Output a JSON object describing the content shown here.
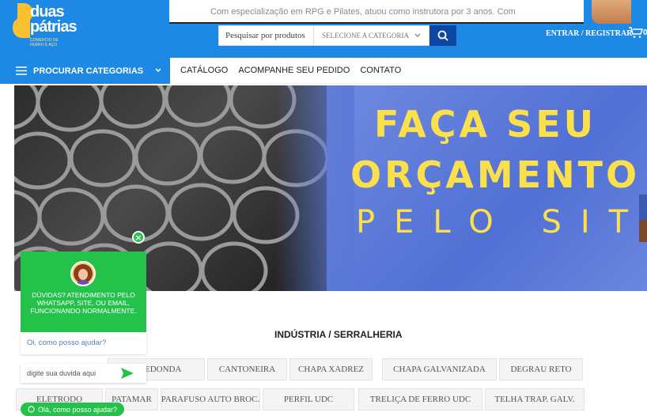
{
  "header": {
    "logo_line1": "duas",
    "logo_line2": "pátrias",
    "logo_tag": "COMERCIO DE FERRO E AÇO",
    "notice": "Com especialização em RPG e Pilates, atuou como instrutora por 3 anos. Com",
    "search_placeholder": "Pesquisar por produtos",
    "category_select": "SELECIONE A CATEGORIA",
    "login_label": "ENTRAR / REGISTRAR",
    "cart_count": "0"
  },
  "nav": {
    "categories_button": "PROCURAR CATEGORIAS",
    "links": [
      "CATÁLOGO",
      "ACOMPANHE SEU PEDIDO",
      "CONTATO"
    ]
  },
  "banner": {
    "line1": "FAÇA SEU",
    "line2": "ORÇAMENTO",
    "line3": "PELO SITE"
  },
  "section": {
    "title": "INDÚSTRIA / SERRALHERIA",
    "chips_row1": [
      "A REDONDA",
      "CANTONEIRA",
      "CHAPA XADREZ",
      "CHAPA GALVANIZADA",
      "DEGRAU RETO"
    ],
    "chips_row2": [
      "ELETRODO",
      "PATAMAR",
      "PARAFUSO AUTO BROC.",
      "PERFIL UDC",
      "TRELIÇA DE FERRO UDC",
      "TELHA TRAP. GALV."
    ]
  },
  "chat": {
    "message": "DÚVIDAS? ATENDIMENTO PELO WHATSAPP, SITE, OU EMAIL, FUNCIONANDO NORMALMENTE.",
    "prompt": "Oi, como posso ajudar?",
    "input_placeholder": "digite sua duvida aqui",
    "bubble_label": "Olá, como posso ajudar?",
    "close_glyph": "×"
  },
  "colors": {
    "primary_blue": "#1e88e5",
    "dark_blue": "#0d47a1",
    "chat_green": "#24c24b",
    "banner_yellow": "#fbe04b"
  },
  "icons": [
    "menu-icon",
    "chevron-down-icon",
    "search-icon",
    "cart-icon",
    "send-icon",
    "whatsapp-icon",
    "close-icon"
  ]
}
